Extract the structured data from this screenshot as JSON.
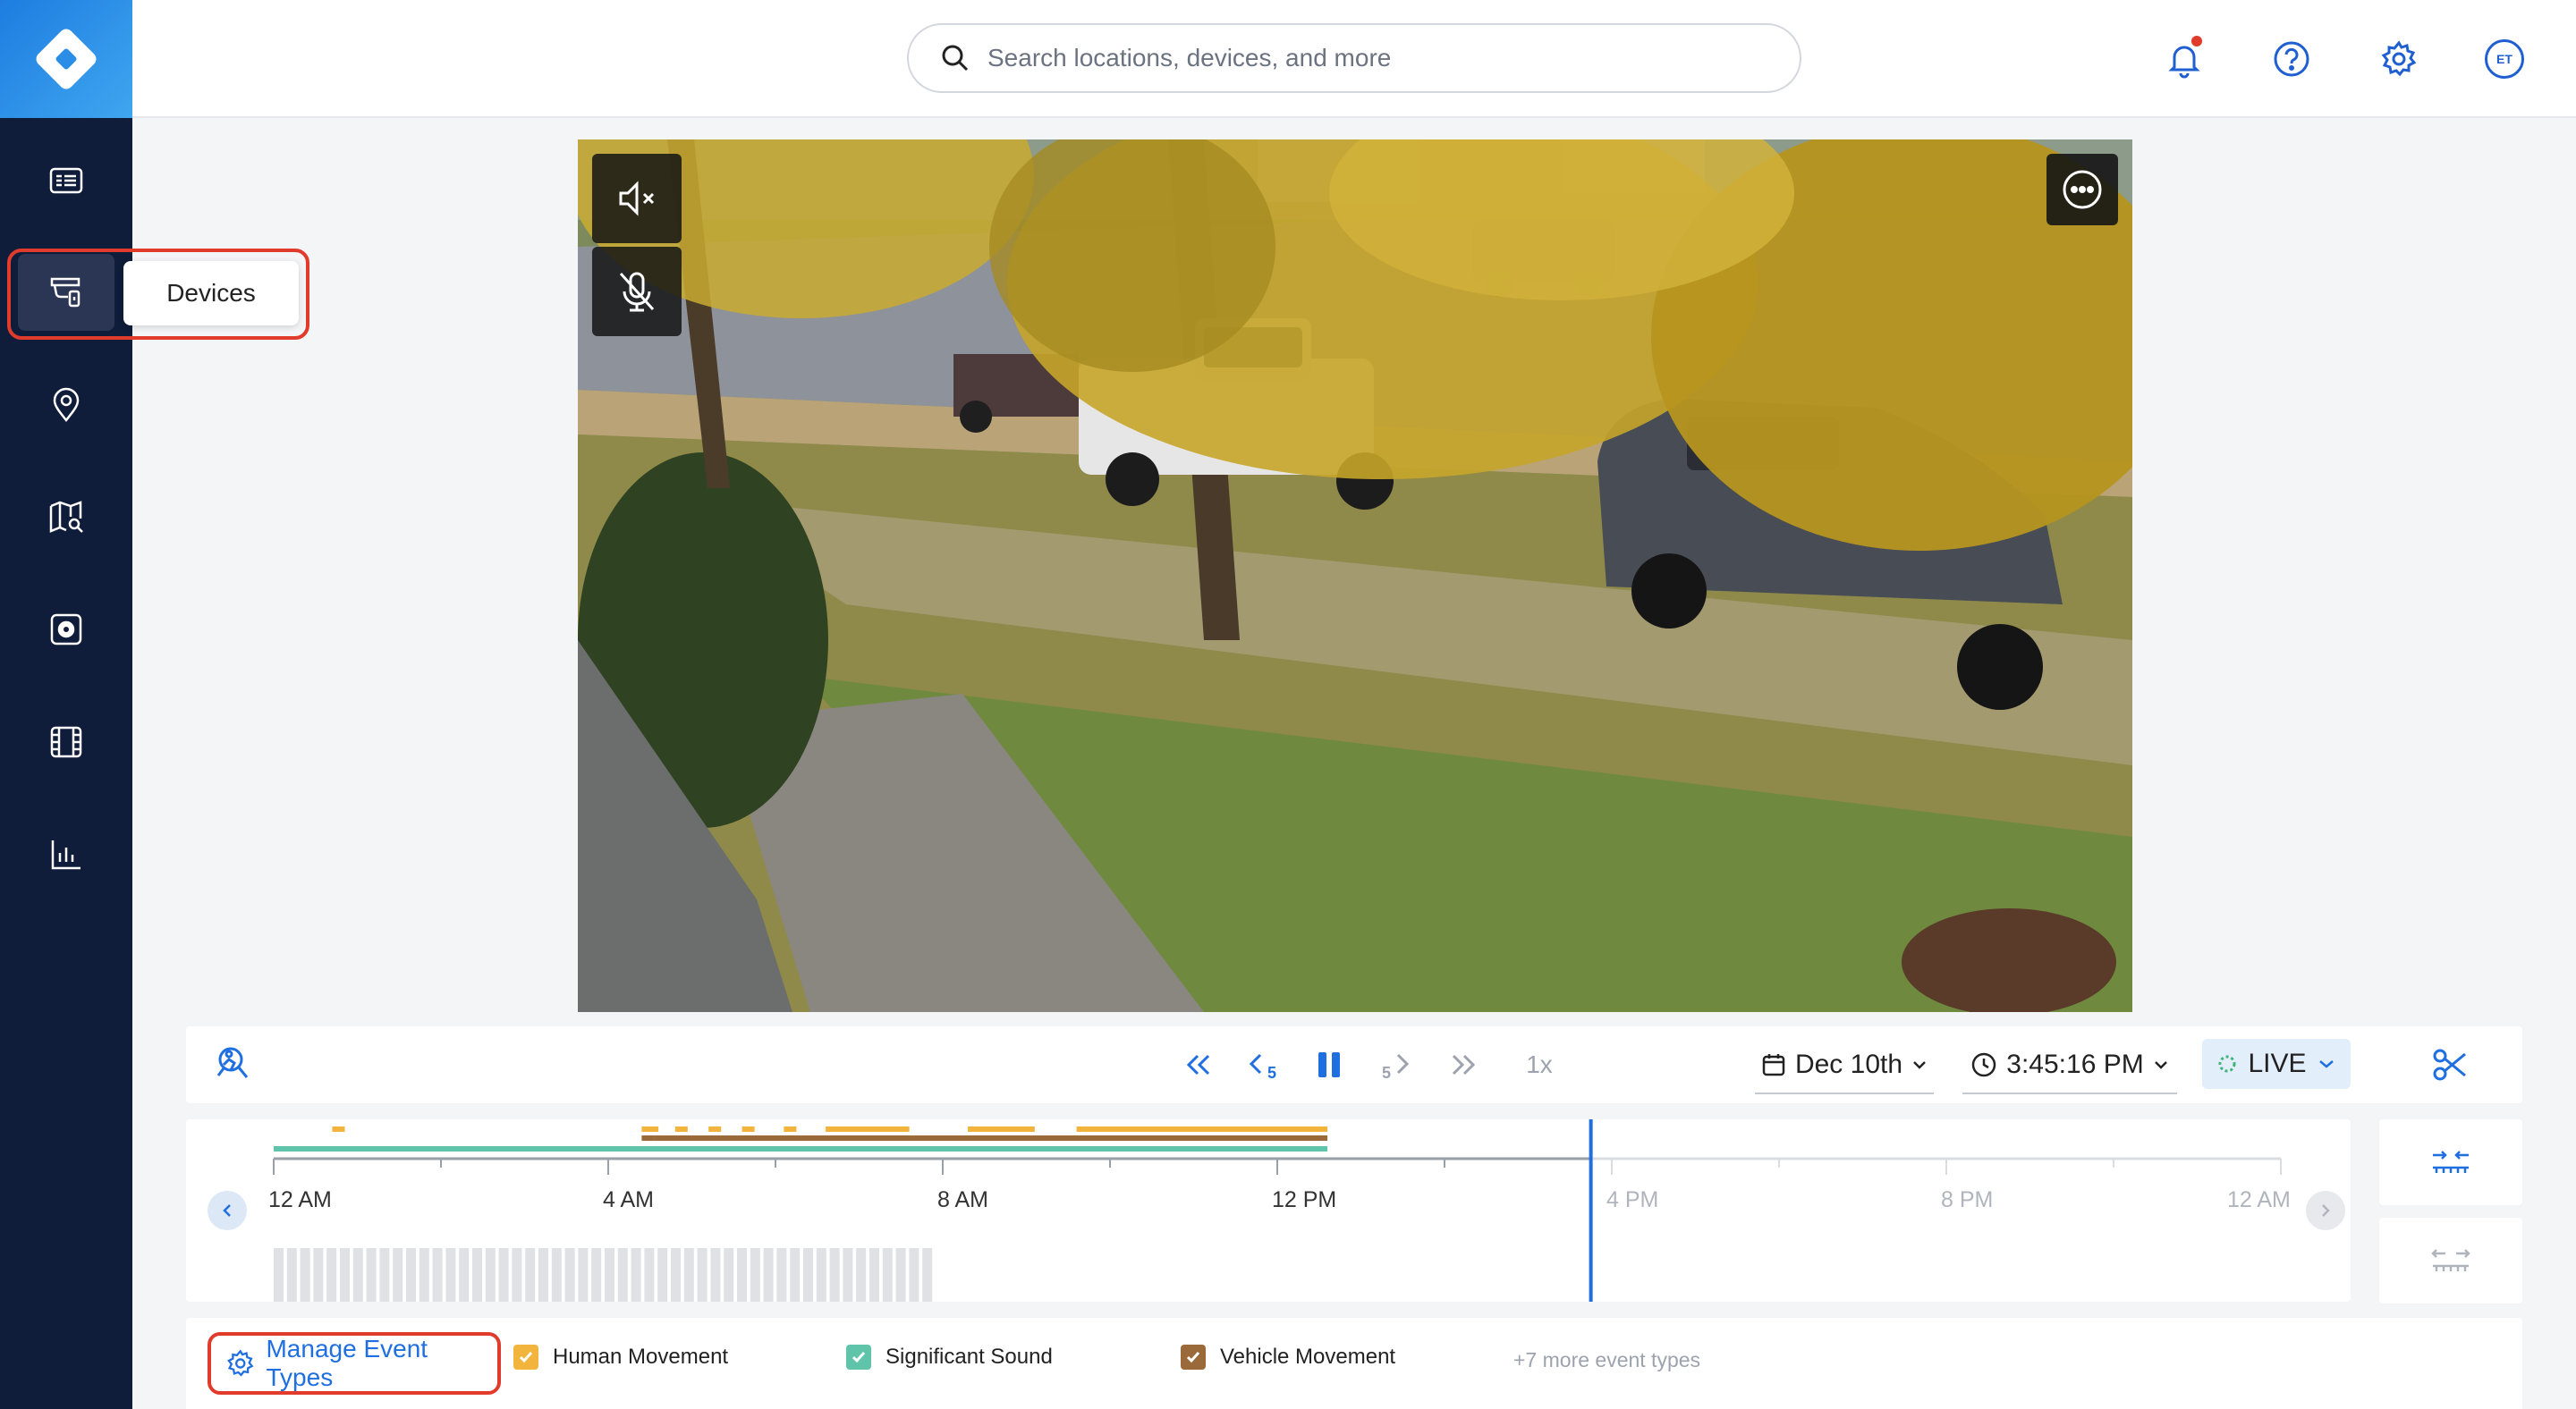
{
  "sidebar": {
    "items": [
      {
        "name": "dashboard",
        "icon": "dashboard-icon"
      },
      {
        "name": "devices",
        "icon": "devices-camera-icon",
        "active": true
      },
      {
        "name": "locations",
        "icon": "location-pin-icon"
      },
      {
        "name": "map",
        "icon": "map-search-icon"
      },
      {
        "name": "security",
        "icon": "security-settings-icon"
      },
      {
        "name": "clips",
        "icon": "film-icon"
      },
      {
        "name": "analytics",
        "icon": "bar-chart-icon"
      }
    ],
    "tooltip": "Devices"
  },
  "header": {
    "search_placeholder": "Search locations, devices, and more",
    "avatar_initials": "ET"
  },
  "player": {
    "speed": "1x",
    "date": "Dec 10th",
    "time": "3:45:16 PM",
    "live_label": "LIVE",
    "skip_back_label": "5",
    "skip_forward_label": "5"
  },
  "timeline": {
    "ticks": [
      {
        "label": "12 AM",
        "future": false
      },
      {
        "label": "4 AM",
        "future": false
      },
      {
        "label": "8 AM",
        "future": false
      },
      {
        "label": "12 PM",
        "future": false
      },
      {
        "label": "4 PM",
        "future": true
      },
      {
        "label": "8 PM",
        "future": true
      },
      {
        "label": "12 AM",
        "future": true
      }
    ],
    "playhead_hour": 15.75
  },
  "legend": {
    "manage_label": "Manage Event Types",
    "items": [
      {
        "label": "Human Movement",
        "color": "#f2b43c"
      },
      {
        "label": "Significant Sound",
        "color": "#5fc4aa"
      },
      {
        "label": "Vehicle Movement",
        "color": "#9a6a3a"
      }
    ],
    "more_label": "+7 more event types"
  },
  "colors": {
    "sidebar_bg": "#0f1c3a",
    "accent": "#1f6fe0",
    "highlight": "#e13b2b"
  }
}
